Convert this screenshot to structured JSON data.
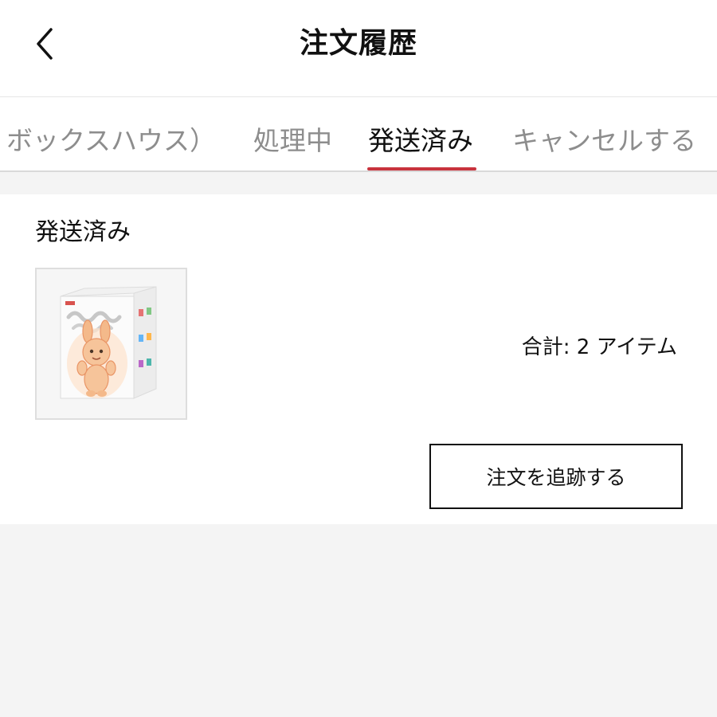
{
  "header": {
    "title": "注文履歴",
    "back_icon": "chevron-left-icon"
  },
  "tabs": [
    {
      "label": "ボックスハウス）",
      "active": false
    },
    {
      "label": "処理中",
      "active": false
    },
    {
      "label": "発送済み",
      "active": true
    },
    {
      "label": "キャンセルする",
      "active": false
    }
  ],
  "order": {
    "status": "発送済み",
    "total_text": "合計: 2 アイテム",
    "track_button_label": "注文を追跡する",
    "product_image": "blind-box-product-image"
  },
  "colors": {
    "accent": "#c8333d",
    "inactive_tab": "#8d8d8d",
    "page_background": "#f4f4f4"
  }
}
